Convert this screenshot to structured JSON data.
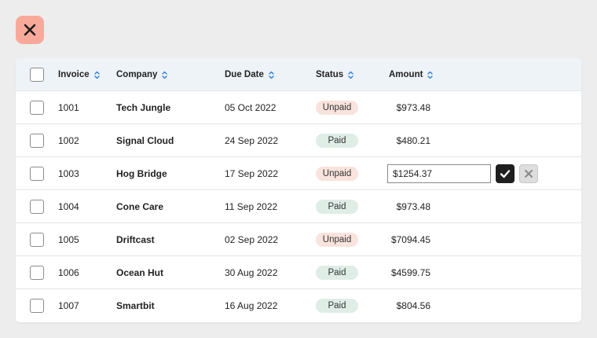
{
  "page": {
    "close_icon": "close-icon",
    "accent_close_bg": "#f9a99a"
  },
  "table": {
    "columns": [
      {
        "key": "invoice",
        "label": "Invoice"
      },
      {
        "key": "company",
        "label": "Company"
      },
      {
        "key": "due_date",
        "label": "Due Date"
      },
      {
        "key": "status",
        "label": "Status"
      },
      {
        "key": "amount",
        "label": "Amount"
      }
    ],
    "sort_icon": "sort-chevrons-icon",
    "sort_icon_color": "#2a7fd4",
    "rows": [
      {
        "invoice": "1001",
        "company": "Tech Jungle",
        "due_date": "05 Oct 2022",
        "status": "Unpaid",
        "amount": "$973.48"
      },
      {
        "invoice": "1002",
        "company": "Signal Cloud",
        "due_date": "24 Sep 2022",
        "status": "Paid",
        "amount": "$480.21"
      },
      {
        "invoice": "1003",
        "company": "Hog Bridge",
        "due_date": "17 Sep 2022",
        "status": "Unpaid",
        "amount": "$1254.37",
        "editing": true,
        "edit_value": "$1254.37"
      },
      {
        "invoice": "1004",
        "company": "Cone Care",
        "due_date": "11 Sep 2022",
        "status": "Paid",
        "amount": "$973.48"
      },
      {
        "invoice": "1005",
        "company": "Driftcast",
        "due_date": "02 Sep 2022",
        "status": "Unpaid",
        "amount": "$7094.45"
      },
      {
        "invoice": "1006",
        "company": "Ocean Hut",
        "due_date": "30 Aug 2022",
        "status": "Paid",
        "amount": "$4599.75"
      },
      {
        "invoice": "1007",
        "company": "Smartbit",
        "due_date": "16 Aug 2022",
        "status": "Paid",
        "amount": "$804.56"
      }
    ],
    "status_colors": {
      "Unpaid": "#f9e3dd",
      "Paid": "#dfede7"
    },
    "edit_actions": {
      "confirm_icon": "check-icon",
      "cancel_icon": "close-icon"
    }
  }
}
